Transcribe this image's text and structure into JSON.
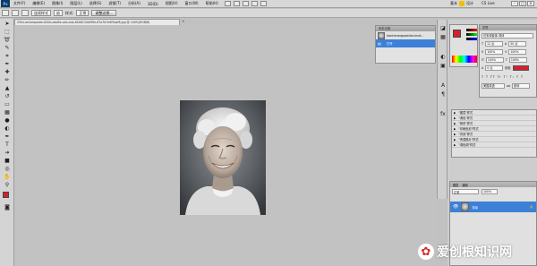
{
  "app": {
    "badge": "Ps"
  },
  "menu": [
    "文件(F)",
    "编辑(E)",
    "图像(I)",
    "图层(L)",
    "选择(S)",
    "滤镜(T)",
    "分析(A)",
    "3D(D)",
    "视图(V)",
    "窗口(W)",
    "帮助(H)"
  ],
  "workspace": {
    "label": "基本",
    "extra": "设计",
    "cs_live": "CS Live"
  },
  "options": {
    "style_label": "样式:",
    "style_value": "正常",
    "mode_label": "连续样式",
    "font_value": "幼",
    "refine_button": "调整边缘..."
  },
  "document": {
    "tab_title": "250x-aninerposter-810b-abd5e-cab-ada-6008134d5f9e-67a7b7e9f5aaf8-jpg @ 100%(RGB/8)"
  },
  "history_panel": {
    "title": "历史记录",
    "items": [
      {
        "label": "Ironhenergsestrler-kndl..."
      },
      {
        "label": "打开"
      }
    ]
  },
  "character_panel": {
    "title": "字符",
    "font_family": "仿宋体繁体-简体",
    "font_size": "12 点",
    "leading": "30 点",
    "tracking": "100%",
    "scale": "100%",
    "baseline": "0 点",
    "color_label": "颜色",
    "language": "美国英语",
    "aa": "锐利"
  },
  "styles_panel": {
    "items": [
      "\"图层\"样式",
      "\"调色\"样式",
      "\"帆布\"样式",
      "\"印刷色彩\"样式",
      "\"背景\"样式",
      "\"黄昏照片\"样式",
      "\"调色调\"样式"
    ]
  },
  "layers_panel": {
    "tabs": [
      "图层",
      "通道"
    ],
    "blend_mode": "正常",
    "opacity": "100%",
    "layer_name": "背景"
  },
  "watermark": {
    "text": "爱创根知识网"
  },
  "colors": {
    "accent": "#3d80d8",
    "fg_color": "#d81f2e",
    "panel_bg": "#e0e0e0"
  }
}
